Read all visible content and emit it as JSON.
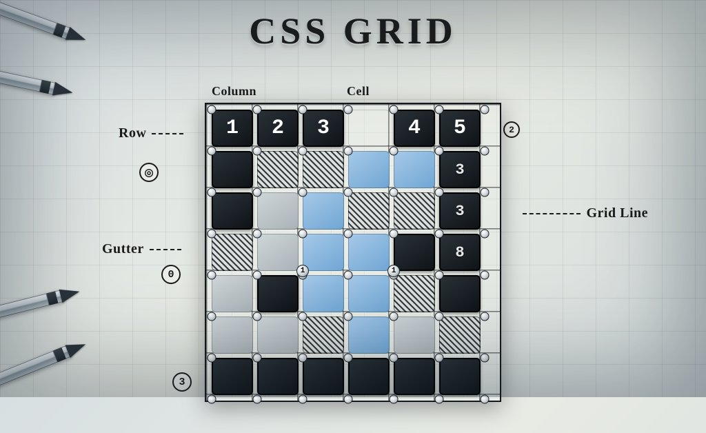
{
  "title": "CSS GRID",
  "labels": {
    "column": "Column",
    "cell": "Cell",
    "row": "Row",
    "gutter": "Gutter",
    "grid_line": "Grid Line"
  },
  "header_numbers": [
    "1",
    "2",
    "3",
    "4",
    "5"
  ],
  "side_markers": {
    "top_right_small": "2",
    "right_col_a": "3",
    "right_col_b": "3",
    "right_col_c": "8",
    "gutter_zero": "0",
    "bottom_left_circle": "3",
    "mid_pin": "1",
    "mid_pin_right": "1"
  },
  "grid_rows": [
    [
      "dark:1",
      "dark:2",
      "dark:3",
      "empty",
      "dark:4",
      "dark:5"
    ],
    [
      "dark",
      "hatch",
      "hatch",
      "blue",
      "blue",
      "dark"
    ],
    [
      "dark",
      "light",
      "blue",
      "hatch",
      "hatch",
      "dark"
    ],
    [
      "hatch",
      "light",
      "blue",
      "blue",
      "dark",
      "dark"
    ],
    [
      "light",
      "dark",
      "blue",
      "blue",
      "hatch",
      "dark"
    ],
    [
      "light",
      "light",
      "hatch",
      "blue",
      "light",
      "hatch"
    ],
    [
      "dark",
      "dark",
      "dark",
      "dark",
      "dark",
      "dark"
    ]
  ]
}
